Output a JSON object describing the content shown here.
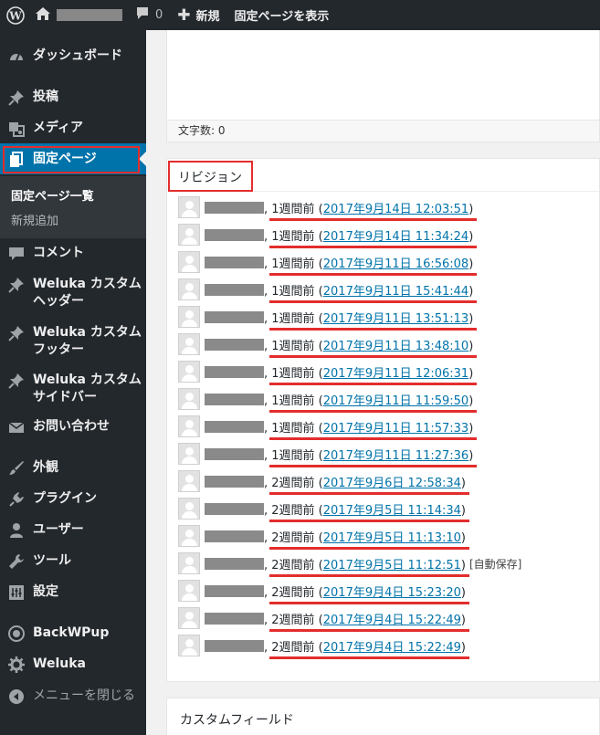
{
  "admin_bar": {
    "comment_count": "0",
    "new_label": "新規",
    "view_page_label": "固定ページを表示"
  },
  "sidebar": {
    "dashboard": "ダッシュボード",
    "posts": "投稿",
    "media": "メディア",
    "pages": "固定ページ",
    "pages_all": "固定ページ一覧",
    "pages_new": "新規追加",
    "comments": "コメント",
    "custom_header": "Weluka カスタムヘッダー",
    "custom_footer": "Weluka カスタムフッター",
    "custom_sidebar": "Weluka カスタムサイドバー",
    "contact": "お問い合わせ",
    "appearance": "外観",
    "plugins": "プラグイン",
    "users": "ユーザー",
    "tools": "ツール",
    "settings": "設定",
    "backwpup": "BackWPup",
    "weluka": "Weluka",
    "collapse": "メニューを閉じる"
  },
  "editor": {
    "word_count": "文字数: 0"
  },
  "revisions": {
    "title": "リビジョン",
    "items": [
      {
        "ago": "1週間前",
        "date": "2017年9月14日 12:03:51",
        "flag": ""
      },
      {
        "ago": "1週間前",
        "date": "2017年9月14日 11:34:24",
        "flag": ""
      },
      {
        "ago": "1週間前",
        "date": "2017年9月11日 16:56:08",
        "flag": ""
      },
      {
        "ago": "1週間前",
        "date": "2017年9月11日 15:41:44",
        "flag": ""
      },
      {
        "ago": "1週間前",
        "date": "2017年9月11日 13:51:13",
        "flag": ""
      },
      {
        "ago": "1週間前",
        "date": "2017年9月11日 13:48:10",
        "flag": ""
      },
      {
        "ago": "1週間前",
        "date": "2017年9月11日 12:06:31",
        "flag": ""
      },
      {
        "ago": "1週間前",
        "date": "2017年9月11日 11:59:50",
        "flag": ""
      },
      {
        "ago": "1週間前",
        "date": "2017年9月11日 11:57:33",
        "flag": ""
      },
      {
        "ago": "1週間前",
        "date": "2017年9月11日 11:27:36",
        "flag": ""
      },
      {
        "ago": "2週間前",
        "date": "2017年9月6日 12:58:34",
        "flag": ""
      },
      {
        "ago": "2週間前",
        "date": "2017年9月5日 11:14:34",
        "flag": ""
      },
      {
        "ago": "2週間前",
        "date": "2017年9月5日 11:13:10",
        "flag": ""
      },
      {
        "ago": "2週間前",
        "date": "2017年9月5日 11:12:51",
        "flag": "[自動保存]"
      },
      {
        "ago": "2週間前",
        "date": "2017年9月4日 15:23:20",
        "flag": ""
      },
      {
        "ago": "2週間前",
        "date": "2017年9月4日 15:22:49",
        "flag": ""
      },
      {
        "ago": "2週間前",
        "date": "2017年9月4日 15:22:49",
        "flag": ""
      }
    ]
  },
  "custom_fields": {
    "title": "カスタムフィールド"
  }
}
